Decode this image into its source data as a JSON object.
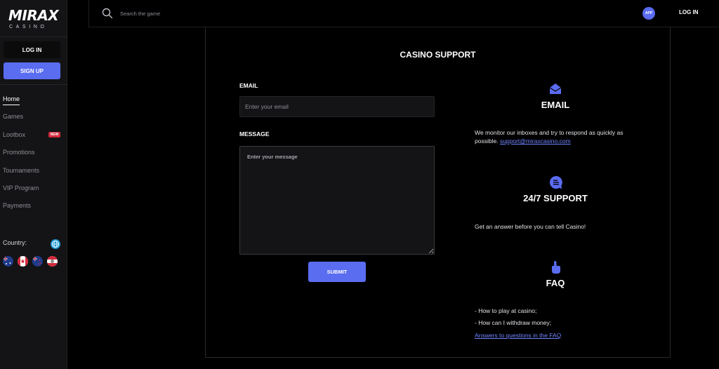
{
  "brand": {
    "logo_main": "MIRAX",
    "logo_sub": "CASINO",
    "accent_color": "#5a6cf0",
    "logo_red": "#d22a3c"
  },
  "sidebar": {
    "login_label": "LOG IN",
    "signup_label": "SIGN UP",
    "items": [
      {
        "label": "Home",
        "active": true
      },
      {
        "label": "Games"
      },
      {
        "label": "Lootbox",
        "badge": "NEW"
      },
      {
        "label": "Promotions"
      },
      {
        "label": "Tournaments"
      },
      {
        "label": "VIP Program"
      },
      {
        "label": "Payments"
      }
    ],
    "country_label": "Country:",
    "flag_icons": [
      "australia-flag-icon",
      "canada-flag-icon",
      "new-zealand-flag-icon",
      "austria-flag-icon"
    ]
  },
  "topbar": {
    "search_placeholder": "Search the game",
    "app_label": "APP",
    "login_label": "LOG IN"
  },
  "support": {
    "title": "CASINO SUPPORT",
    "email_label": "EMAIL",
    "email_placeholder": "Enter your email",
    "message_label": "MESSAGE",
    "message_placeholder": "Enter your message",
    "submit_label": "SUBMIT",
    "email_block": {
      "heading": "EMAIL",
      "text": "We monitor our inboxes and try to respond as quickly as possible.",
      "link": "support@miraxcasino.com"
    },
    "support_block": {
      "heading": "24/7 SUPPORT",
      "text": "Get an answer before you can tell Casino!"
    },
    "faq_block": {
      "heading": "FAQ",
      "line1": "- How to play at casino;",
      "line2": "- How can I withdraw money;",
      "link": "Answers to questions in the FAQ"
    }
  }
}
